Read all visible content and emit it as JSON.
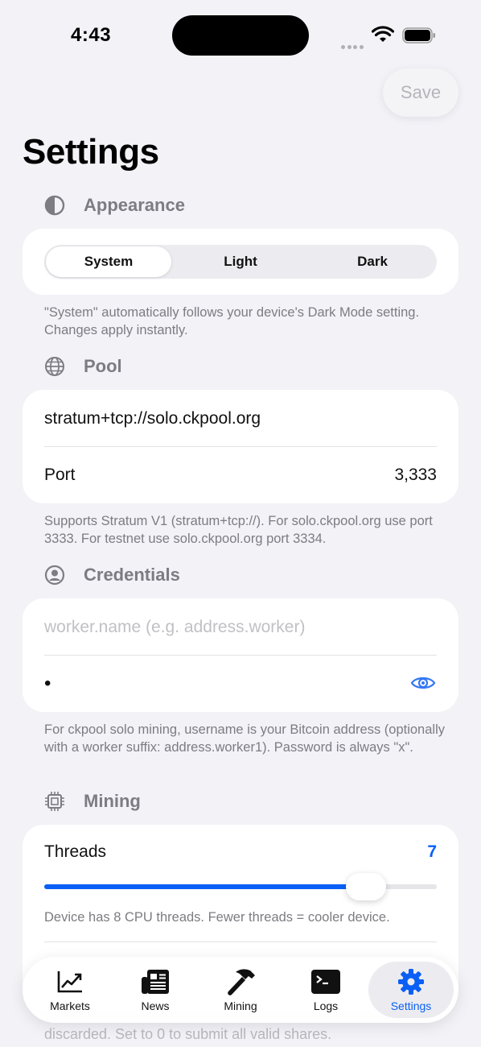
{
  "status": {
    "time": "4:43"
  },
  "toolbar": {
    "save_label": "Save"
  },
  "page": {
    "title": "Settings"
  },
  "appearance": {
    "header": "Appearance",
    "options": [
      "System",
      "Light",
      "Dark"
    ],
    "selected": "System",
    "footnote": "\"System\" automatically follows your device's Dark Mode setting. Changes apply instantly."
  },
  "pool": {
    "header": "Pool",
    "url": "stratum+tcp://solo.ckpool.org",
    "port_label": "Port",
    "port_value": "3,333",
    "footnote": "Supports Stratum V1 (stratum+tcp://). For solo.ckpool.org use port 3333. For testnet use solo.ckpool.org port 3334."
  },
  "credentials": {
    "header": "Credentials",
    "username_placeholder": "worker.name (e.g. address.worker)",
    "password_value": "•",
    "footnote": "For ckpool solo mining, username is your Bitcoin address (optionally with a worker suffix: address.worker1). Password is always \"x\"."
  },
  "mining": {
    "header": "Mining",
    "threads_label": "Threads",
    "threads_value": "7",
    "threads_max": 8,
    "threads_fraction": 0.82,
    "threads_note": "Device has 8 CPU threads. Fewer threads = cooler device.",
    "obscured_footnote": "discarded. Set to 0 to submit all valid shares."
  },
  "tabs": [
    {
      "label": "Markets",
      "icon": "chart-line-icon"
    },
    {
      "label": "News",
      "icon": "newspaper-icon"
    },
    {
      "label": "Mining",
      "icon": "hammer-icon"
    },
    {
      "label": "Logs",
      "icon": "terminal-icon"
    },
    {
      "label": "Settings",
      "icon": "gear-icon",
      "active": true
    }
  ],
  "colors": {
    "accent": "#0A5FF5",
    "background": "#F2F2F7",
    "secondary_text": "#7C7C82"
  }
}
